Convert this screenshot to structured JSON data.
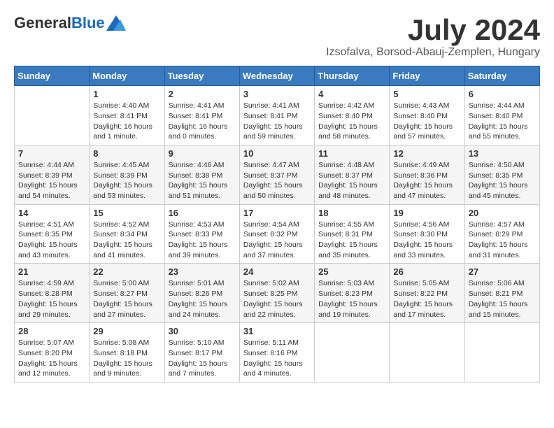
{
  "header": {
    "logo_general": "General",
    "logo_blue": "Blue",
    "month_title": "July 2024",
    "location": "Izsofalva, Borsod-Abauj-Zemplen, Hungary"
  },
  "calendar": {
    "days_of_week": [
      "Sunday",
      "Monday",
      "Tuesday",
      "Wednesday",
      "Thursday",
      "Friday",
      "Saturday"
    ],
    "weeks": [
      [
        {
          "day": "",
          "info": ""
        },
        {
          "day": "1",
          "info": "Sunrise: 4:40 AM\nSunset: 8:41 PM\nDaylight: 16 hours\nand 1 minute."
        },
        {
          "day": "2",
          "info": "Sunrise: 4:41 AM\nSunset: 8:41 PM\nDaylight: 16 hours\nand 0 minutes."
        },
        {
          "day": "3",
          "info": "Sunrise: 4:41 AM\nSunset: 8:41 PM\nDaylight: 15 hours\nand 59 minutes."
        },
        {
          "day": "4",
          "info": "Sunrise: 4:42 AM\nSunset: 8:40 PM\nDaylight: 15 hours\nand 58 minutes."
        },
        {
          "day": "5",
          "info": "Sunrise: 4:43 AM\nSunset: 8:40 PM\nDaylight: 15 hours\nand 57 minutes."
        },
        {
          "day": "6",
          "info": "Sunrise: 4:44 AM\nSunset: 8:40 PM\nDaylight: 15 hours\nand 55 minutes."
        }
      ],
      [
        {
          "day": "7",
          "info": "Sunrise: 4:44 AM\nSunset: 8:39 PM\nDaylight: 15 hours\nand 54 minutes."
        },
        {
          "day": "8",
          "info": "Sunrise: 4:45 AM\nSunset: 8:39 PM\nDaylight: 15 hours\nand 53 minutes."
        },
        {
          "day": "9",
          "info": "Sunrise: 4:46 AM\nSunset: 8:38 PM\nDaylight: 15 hours\nand 51 minutes."
        },
        {
          "day": "10",
          "info": "Sunrise: 4:47 AM\nSunset: 8:37 PM\nDaylight: 15 hours\nand 50 minutes."
        },
        {
          "day": "11",
          "info": "Sunrise: 4:48 AM\nSunset: 8:37 PM\nDaylight: 15 hours\nand 48 minutes."
        },
        {
          "day": "12",
          "info": "Sunrise: 4:49 AM\nSunset: 8:36 PM\nDaylight: 15 hours\nand 47 minutes."
        },
        {
          "day": "13",
          "info": "Sunrise: 4:50 AM\nSunset: 8:35 PM\nDaylight: 15 hours\nand 45 minutes."
        }
      ],
      [
        {
          "day": "14",
          "info": "Sunrise: 4:51 AM\nSunset: 8:35 PM\nDaylight: 15 hours\nand 43 minutes."
        },
        {
          "day": "15",
          "info": "Sunrise: 4:52 AM\nSunset: 8:34 PM\nDaylight: 15 hours\nand 41 minutes."
        },
        {
          "day": "16",
          "info": "Sunrise: 4:53 AM\nSunset: 8:33 PM\nDaylight: 15 hours\nand 39 minutes."
        },
        {
          "day": "17",
          "info": "Sunrise: 4:54 AM\nSunset: 8:32 PM\nDaylight: 15 hours\nand 37 minutes."
        },
        {
          "day": "18",
          "info": "Sunrise: 4:55 AM\nSunset: 8:31 PM\nDaylight: 15 hours\nand 35 minutes."
        },
        {
          "day": "19",
          "info": "Sunrise: 4:56 AM\nSunset: 8:30 PM\nDaylight: 15 hours\nand 33 minutes."
        },
        {
          "day": "20",
          "info": "Sunrise: 4:57 AM\nSunset: 8:29 PM\nDaylight: 15 hours\nand 31 minutes."
        }
      ],
      [
        {
          "day": "21",
          "info": "Sunrise: 4:59 AM\nSunset: 8:28 PM\nDaylight: 15 hours\nand 29 minutes."
        },
        {
          "day": "22",
          "info": "Sunrise: 5:00 AM\nSunset: 8:27 PM\nDaylight: 15 hours\nand 27 minutes."
        },
        {
          "day": "23",
          "info": "Sunrise: 5:01 AM\nSunset: 8:26 PM\nDaylight: 15 hours\nand 24 minutes."
        },
        {
          "day": "24",
          "info": "Sunrise: 5:02 AM\nSunset: 8:25 PM\nDaylight: 15 hours\nand 22 minutes."
        },
        {
          "day": "25",
          "info": "Sunrise: 5:03 AM\nSunset: 8:23 PM\nDaylight: 15 hours\nand 19 minutes."
        },
        {
          "day": "26",
          "info": "Sunrise: 5:05 AM\nSunset: 8:22 PM\nDaylight: 15 hours\nand 17 minutes."
        },
        {
          "day": "27",
          "info": "Sunrise: 5:06 AM\nSunset: 8:21 PM\nDaylight: 15 hours\nand 15 minutes."
        }
      ],
      [
        {
          "day": "28",
          "info": "Sunrise: 5:07 AM\nSunset: 8:20 PM\nDaylight: 15 hours\nand 12 minutes."
        },
        {
          "day": "29",
          "info": "Sunrise: 5:08 AM\nSunset: 8:18 PM\nDaylight: 15 hours\nand 9 minutes."
        },
        {
          "day": "30",
          "info": "Sunrise: 5:10 AM\nSunset: 8:17 PM\nDaylight: 15 hours\nand 7 minutes."
        },
        {
          "day": "31",
          "info": "Sunrise: 5:11 AM\nSunset: 8:16 PM\nDaylight: 15 hours\nand 4 minutes."
        },
        {
          "day": "",
          "info": ""
        },
        {
          "day": "",
          "info": ""
        },
        {
          "day": "",
          "info": ""
        }
      ]
    ]
  }
}
